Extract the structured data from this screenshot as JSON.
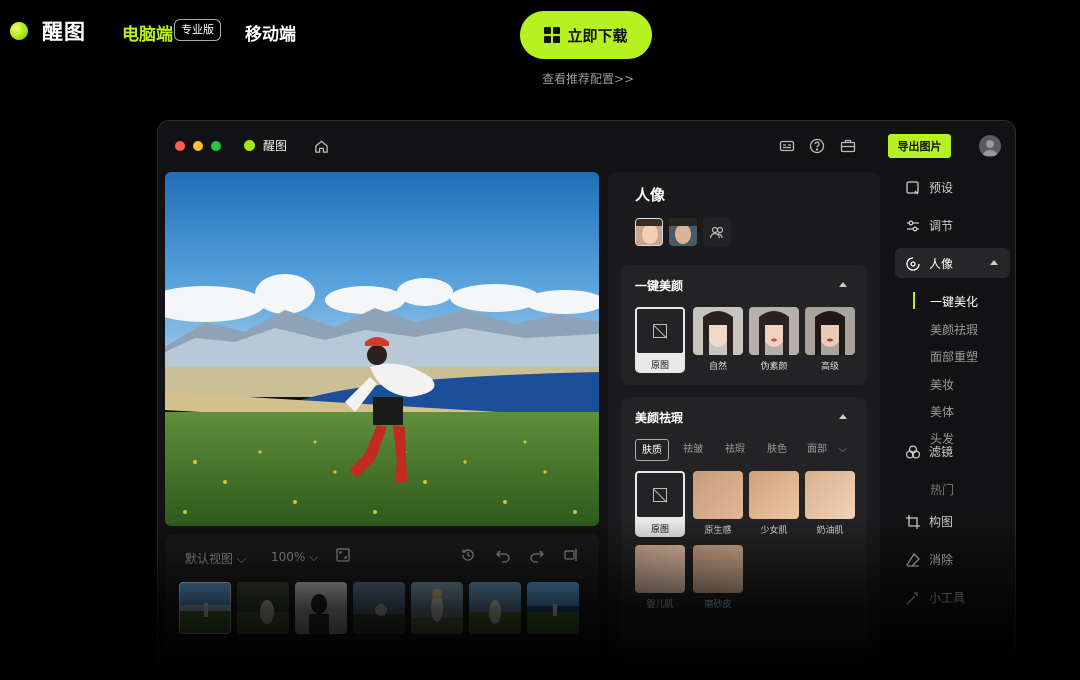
{
  "site": {
    "logo_text": "醒图",
    "nav_desktop": "电脑端",
    "nav_badge": "专业版",
    "nav_mobile": "移动端",
    "download_label": "立即下载",
    "config_link": "查看推荐配置>>"
  },
  "app": {
    "name": "醒图",
    "export_label": "导出图片",
    "bottom": {
      "view_label": "默认视图",
      "zoom_label": "100%"
    },
    "panel": {
      "title": "人像",
      "section1": {
        "title": "一键美颜",
        "effects": [
          "原图",
          "自然",
          "伪素颜",
          "高级"
        ]
      },
      "section2": {
        "title": "美颜祛瑕",
        "subtabs": [
          "肤质",
          "祛皱",
          "祛瑕",
          "肤色",
          "面部"
        ],
        "effects": [
          "原图",
          "原生感",
          "少女肌",
          "奶油肌",
          "婴儿肌",
          "磨砂皮"
        ]
      }
    },
    "side": {
      "items": [
        "预设",
        "调节",
        "人像",
        "滤镜",
        "构图",
        "消除",
        "小工具"
      ],
      "sub_items": [
        "一键美化",
        "美颜祛瑕",
        "面部重塑",
        "美妆",
        "美体",
        "头发",
        "热门"
      ]
    }
  },
  "colors": {
    "accent": "#b6f21f",
    "background": "#000000",
    "window": "#121214",
    "panel": "#1b1b1d"
  }
}
